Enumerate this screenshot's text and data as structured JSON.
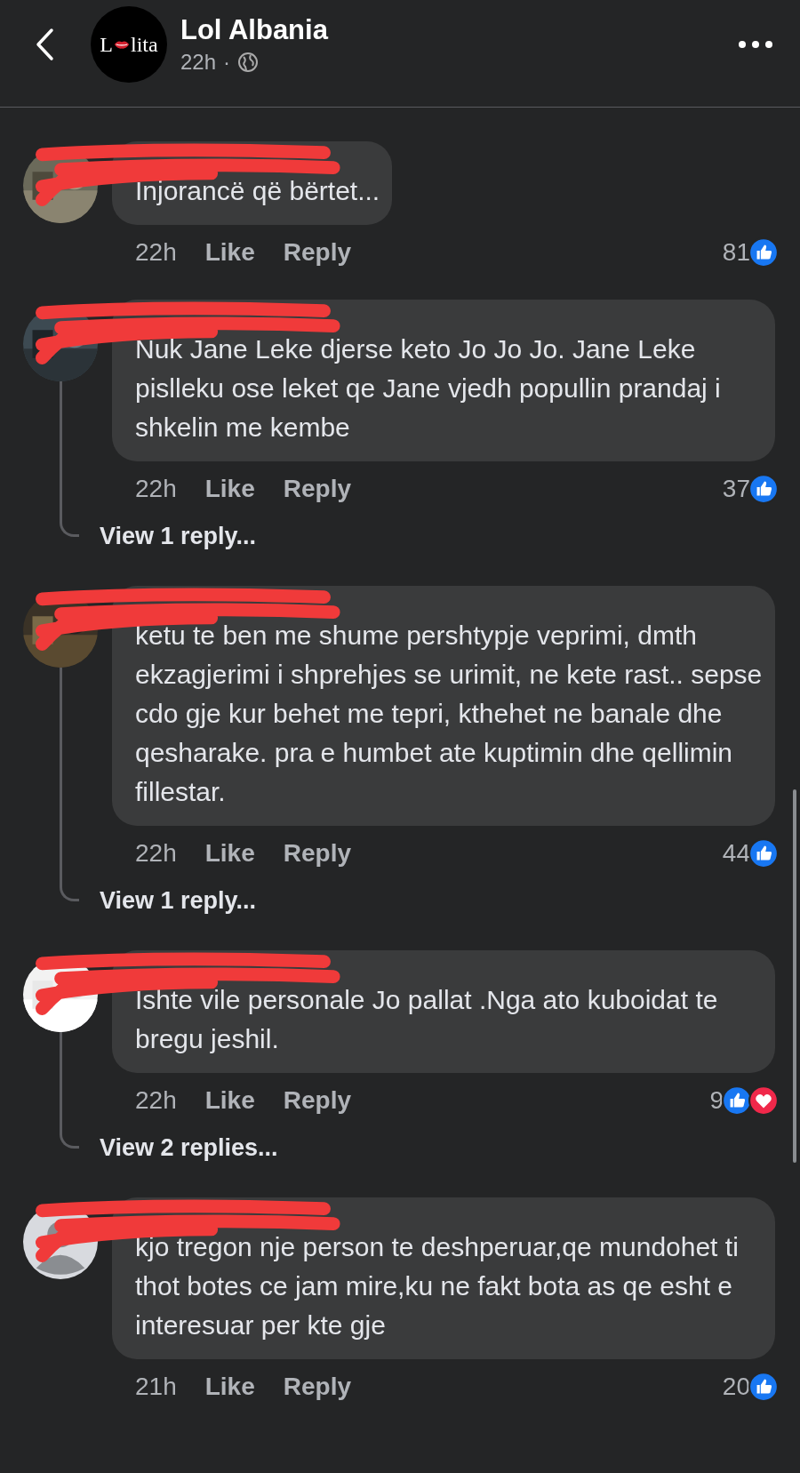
{
  "header": {
    "logo": {
      "start": "L",
      "end": "lita"
    },
    "page_name": "Lol Albania",
    "time": "22h",
    "separator": "·"
  },
  "comments": [
    {
      "avatar": {
        "kind": "picture"
      },
      "text": "Injorancë që bërtet...",
      "time": "22h",
      "like": "Like",
      "reply": "Reply",
      "count": "81",
      "reactions": [
        {
          "kind": "like"
        }
      ]
    },
    {
      "avatar": {
        "kind": "picture"
      },
      "text": "Nuk Jane Leke djerse keto Jo Jo Jo. Jane Leke pislleku ose leket qe Jane vjedh popullin prandaj i shkelin me kembe",
      "time": "22h",
      "like": "Like",
      "reply": "Reply",
      "count": "37",
      "reactions": [
        {
          "kind": "like"
        }
      ],
      "replies_link": "View 1 reply..."
    },
    {
      "avatar": {
        "kind": "picture"
      },
      "text": "ketu te ben me shume  pershtypje veprimi, dmth  ekzagjerimi i shprehjes se urimit, ne kete rast..  sepse cdo gje kur behet me  tepri, kthehet  ne banale dhe qesharake.  pra e humbet  ate kuptimin dhe qellimin fillestar.",
      "time": "22h",
      "like": "Like",
      "reply": "Reply",
      "count": "44",
      "reactions": [
        {
          "kind": "like"
        }
      ],
      "replies_link": "View 1 reply..."
    },
    {
      "avatar": {
        "kind": "picture"
      },
      "text": "Ishte vile personale Jo pallat .Nga ato kuboidat te bregu jeshil.",
      "time": "22h",
      "like": "Like",
      "reply": "Reply",
      "count": "9",
      "reactions": [
        {
          "kind": "like"
        },
        {
          "kind": "love"
        }
      ],
      "replies_link": "View 2 replies..."
    },
    {
      "avatar": {
        "kind": "default"
      },
      "text": "kjo tregon nje person te deshperuar,qe mundohet ti thot botes ce jam mire,ku ne fakt bota as qe esht e interesuar per kte gje",
      "time": "21h",
      "like": "Like",
      "reply": "Reply",
      "count": "20",
      "reactions": [
        {
          "kind": "like"
        }
      ]
    }
  ]
}
